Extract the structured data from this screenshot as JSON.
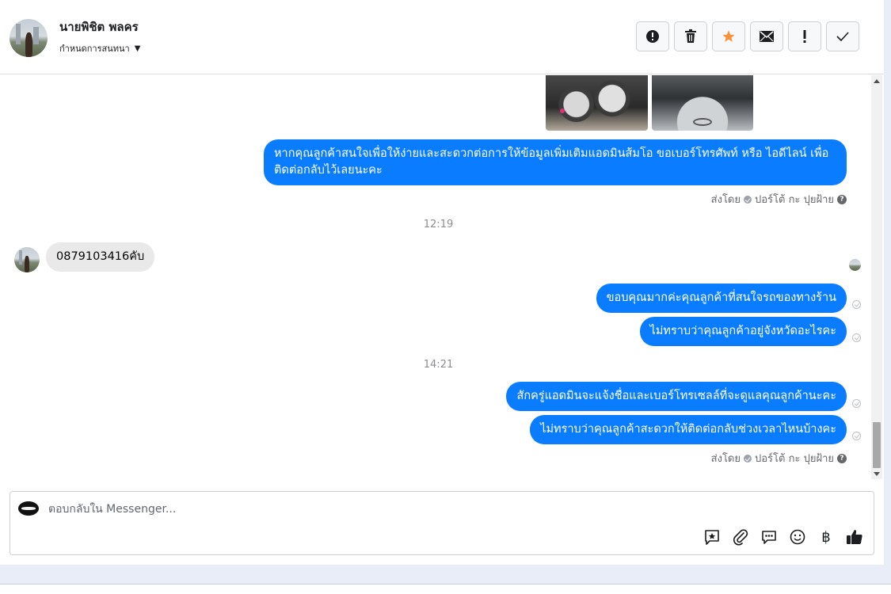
{
  "header": {
    "contact_name": "นายพิชิต พลคร",
    "assign_label": "กำหนดการสนทนา",
    "actions": [
      {
        "name": "mark-spam-button",
        "icon": "alert-circle-icon"
      },
      {
        "name": "delete-button",
        "icon": "trash-icon"
      },
      {
        "name": "star-button",
        "icon": "star-icon",
        "color": "#f7923b"
      },
      {
        "name": "mark-unread-button",
        "icon": "envelope-icon"
      },
      {
        "name": "follow-up-button",
        "icon": "exclamation-icon"
      },
      {
        "name": "mark-done-button",
        "icon": "checkmark-icon"
      }
    ]
  },
  "conversation": {
    "messages": [
      {
        "type": "out",
        "text": "หากคุณลูกค้าสนใจเพื่อให้ง่ายและสะดวกต่อการให้ข้อมูลเพิ่มเติมแอดมินส้มโอ ขอเบอร์โทรศัพท์ หรือ ไอดีไลน์ เพื่อติดต่อกลับไว้เลยนะคะ"
      },
      {
        "type": "out",
        "text": "ขอบคุณมากค่ะคุณลูกค้าที่สนใจรถของทางร้าน"
      },
      {
        "type": "out",
        "text": "ไม่ทราบว่าคุณลูกค้าอยู่จังหวัดอะไรคะ"
      },
      {
        "type": "out",
        "text": "สักครู่แอดมินจะแจ้งชื่อและเบอร์โทรเซลล์ที่จะดูแลคุณลูกค้านะคะ"
      },
      {
        "type": "out",
        "text": "ไม่ทราบว่าคุณลูกค้าสะดวกให้ติดต่อกลับช่วงเวลาไหนบ้างคะ"
      },
      {
        "type": "in",
        "text": "0879103416คับ"
      }
    ],
    "sent_by_prefix": "ส่งโดย",
    "sent_by_name": "ปอร์โต้ กะ ปุยฝ้าย",
    "help_icon": "?",
    "timestamps": [
      "12:19",
      "14:21"
    ]
  },
  "composer": {
    "placeholder": "ตอบกลับใน Messenger...",
    "tools": [
      "saved-reply-icon",
      "attachment-icon",
      "messenger-icon",
      "emoji-icon",
      "baht-icon",
      "thumbs-up-icon"
    ],
    "baht_symbol": "฿"
  },
  "colors": {
    "outgoing_bubble": "#0a7cff",
    "incoming_bubble": "#e9e9ea",
    "accent_star": "#f7923b"
  }
}
